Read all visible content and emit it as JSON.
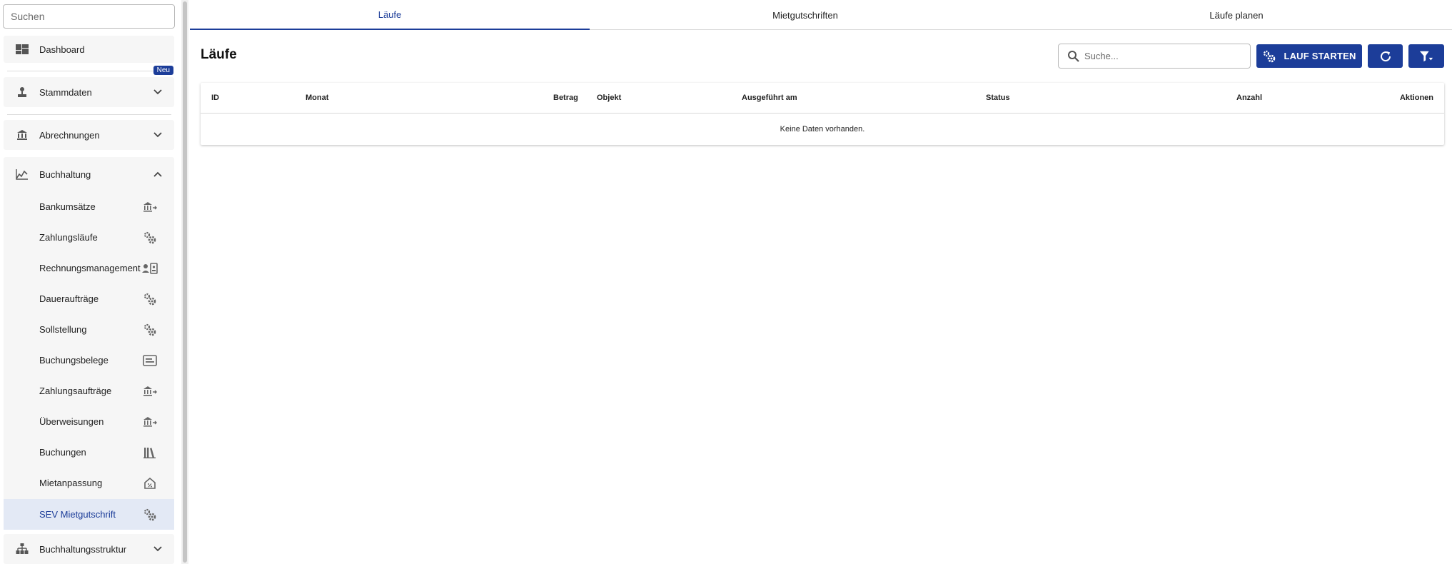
{
  "sidebar": {
    "search_placeholder": "Suchen",
    "dashboard": {
      "label": "Dashboard",
      "icon": "dashboard-icon"
    },
    "stammdaten": {
      "label": "Stammdaten",
      "badge": "Neu",
      "icon": "person-tree-icon"
    },
    "abrechnungen": {
      "label": "Abrechnungen",
      "icon": "bank-icon"
    },
    "buchhaltung": {
      "label": "Buchhaltung",
      "icon": "chart-icon",
      "items": [
        {
          "label": "Bankumsätze",
          "icon": "bank-arrows-icon"
        },
        {
          "label": "Zahlungsläufe",
          "icon": "gears-icon"
        },
        {
          "label": "Rechnungsmanagement",
          "icon": "contact-card-icon"
        },
        {
          "label": "Daueraufträge",
          "icon": "gears-icon"
        },
        {
          "label": "Sollstellung",
          "icon": "gears-icon"
        },
        {
          "label": "Buchungsbelege",
          "icon": "document-icon"
        },
        {
          "label": "Zahlungsaufträge",
          "icon": "bank-arrows-icon"
        },
        {
          "label": "Überweisungen",
          "icon": "bank-arrows-icon"
        },
        {
          "label": "Buchungen",
          "icon": "books-icon"
        },
        {
          "label": "Mietanpassung",
          "icon": "house-percent-icon"
        },
        {
          "label": "SEV Mietgutschrift",
          "icon": "gears-icon",
          "active": true
        }
      ]
    },
    "buchhaltungsstruktur": {
      "label": "Buchhaltungsstruktur",
      "icon": "hierarchy-icon"
    }
  },
  "tabs": [
    {
      "label": "Läufe",
      "active": true
    },
    {
      "label": "Mietgutschriften"
    },
    {
      "label": "Läufe planen"
    }
  ],
  "main": {
    "title": "Läufe",
    "search_placeholder": "Suche...",
    "start_button": "LAUF STARTEN",
    "table": {
      "headers": [
        "ID",
        "Monat",
        "Betrag",
        "Objekt",
        "Ausgeführt am",
        "Status",
        "Anzahl",
        "Aktionen"
      ],
      "empty_text": "Keine Daten vorhanden."
    }
  },
  "colors": {
    "primary": "#1c3d99",
    "active_bg": "#e3e9f5",
    "panel_bg": "#f6f6f6"
  }
}
